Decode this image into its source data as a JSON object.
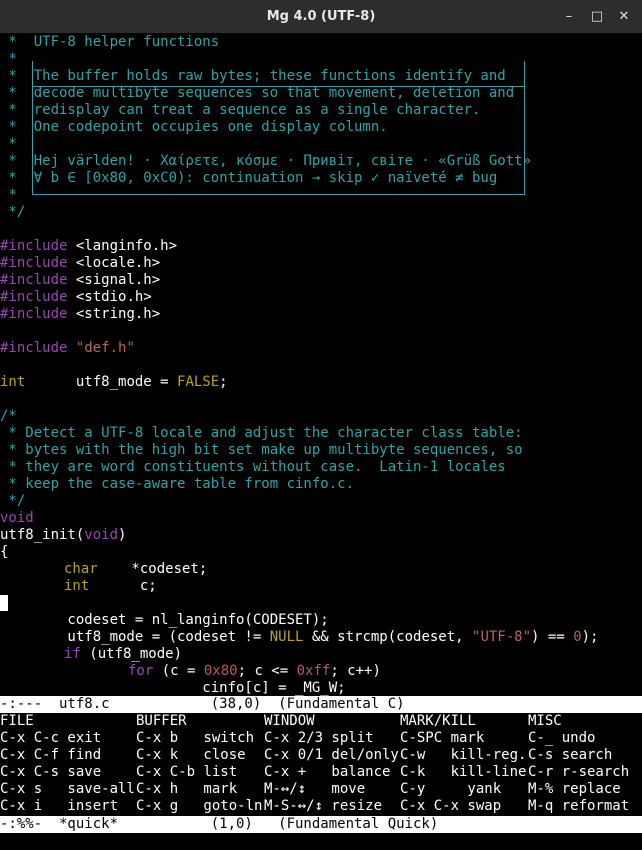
{
  "window": {
    "title": "Mg 4.0 (UTF-8)",
    "min_glyph": "–",
    "max_glyph": "□",
    "close_glyph": "✕"
  },
  "code": {
    "l01": " *  UTF-8 helper functions",
    "l02": " *",
    "l03": " *  The buffer holds raw bytes; these functions identify and",
    "l04": " *  decode multibyte sequences so that movement, deletion and",
    "l05": " *  redisplay can treat a sequence as a single character.",
    "l06": " *  One codepoint occupies one display column.",
    "l07": " *",
    "l08": " *  Hej världen! · Χαίρετε, κόσμε · Привіт, світе · «Grüß Gott»",
    "l09": " *  ∀ b ∈ [0x80, 0xC0): continuation → skip ✓ naïveté ≠ bug",
    "l10": " *",
    "l11": " */",
    "inc_kw": "#include",
    "inc1": " <langinfo.h>",
    "inc2": " <locale.h>",
    "inc3": " <signal.h>",
    "inc4": " <stdio.h>",
    "inc5": " <string.h>",
    "inc6": " \"def.h\"",
    "decl_type": "int",
    "decl_mid": "      utf8_mode = ",
    "decl_false": "FALSE",
    "decl_end": ";",
    "c1": "/*",
    "c2": " * Detect a UTF-8 locale and adjust the character class table:",
    "c3": " * bytes with the high bit set make up multibyte sequences, so",
    "c4": " * they are word constituents without case.  Latin-1 locales",
    "c5": " * keep the case-aware table from cinfo.c.",
    "c6": " */",
    "void_kw": "void",
    "fn_name": "utf8_init(",
    "fn_void": "void",
    "fn_close": ")",
    "brace": "{",
    "v1_type": "char",
    "v1_name": "    *codeset;",
    "v2_type": "int",
    "v2_name": "      c;",
    "a1": "        codeset = nl_langinfo(CODESET);",
    "a2_p1": "        utf8_mode = (codeset != ",
    "a2_null": "NULL",
    "a2_p2": " && strcmp(codeset, ",
    "a2_str": "\"UTF-8\"",
    "a2_p3": ") == ",
    "a2_zero": "0",
    "a2_p4": ");",
    "if_kw": "if",
    "if_rest": " (utf8_mode)",
    "for_kw": "for",
    "for_p1": " (c = ",
    "for_n1": "0x80",
    "for_p2": "; c <= ",
    "for_n2": "0xff",
    "for_p3": "; c++)",
    "cinfo": "                        cinfo[c] = _MG_W;"
  },
  "modeline": "-:---  utf8.c            (38,0)  (Fundamental C)",
  "menu": {
    "col1": [
      "FILE",
      "C-x C-c exit",
      "C-x C-f find",
      "C-x C-s save",
      "C-x s   save-all",
      "C-x i   insert"
    ],
    "col2": [
      "BUFFER",
      "C-x b   switch",
      "C-x k   close",
      "C-x C-b list",
      "C-x h   mark",
      "C-x g   goto-ln"
    ],
    "col3": [
      "WINDOW",
      "C-x 2/3 split",
      "C-x 0/1 del/only",
      "C-x +   balance",
      "M-↔/↕   move",
      "M-S-↔/↕ resize"
    ],
    "col4": [
      "MARK/KILL",
      "C-SPC mark",
      "C-w   kill-reg.",
      "C-k   kill-line",
      "C-y     yank",
      "C-x C-x swap"
    ],
    "col5": [
      "MISC",
      "C-_ undo",
      "C-s search",
      "C-r r-search",
      "M-% replace",
      "M-q reformat"
    ]
  },
  "modeline2": "-:%%-  *quick*           (1,0)   (Fundamental Quick)",
  "colors": {
    "comment": "#2fa3a8",
    "keyword": "#9b45b3",
    "type": "#b5a22a",
    "string": "#c06161"
  }
}
